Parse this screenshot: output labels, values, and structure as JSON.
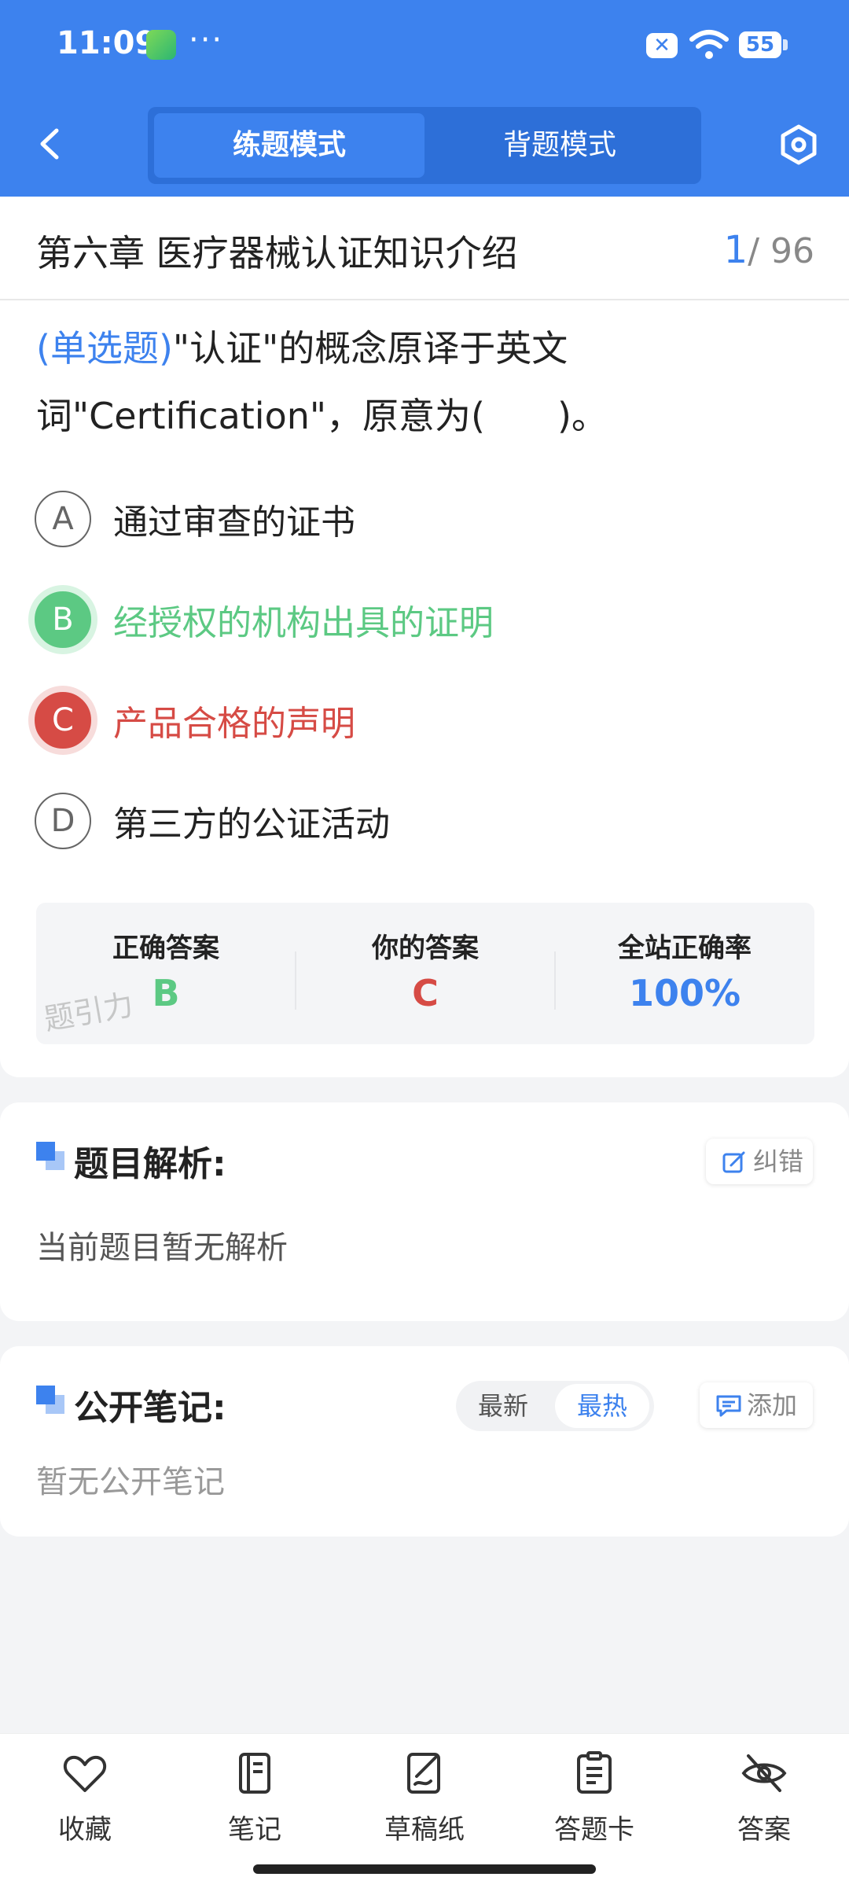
{
  "status_bar": {
    "time": "11:09",
    "more": "···",
    "battery": "55"
  },
  "header": {
    "tabs": [
      {
        "label": "练题模式",
        "active": true
      },
      {
        "label": "背题模式",
        "active": false
      }
    ]
  },
  "question": {
    "chapter": "第六章 医疗器械认证知识介绍",
    "progress_current": "1",
    "progress_total": "/ 96",
    "type": "(单选题)",
    "text": "\"认证\"的概念原译于英文词\"Certification\"，原意为(　　)。",
    "options": [
      {
        "letter": "A",
        "text": "通过审查的证书",
        "state": "normal"
      },
      {
        "letter": "B",
        "text": "经授权的机构出具的证明",
        "state": "correct"
      },
      {
        "letter": "C",
        "text": "产品合格的声明",
        "state": "wrong"
      },
      {
        "letter": "D",
        "text": "第三方的公证活动",
        "state": "normal"
      }
    ]
  },
  "answer_summary": {
    "correct_label": "正确答案",
    "correct_value": "B",
    "yours_label": "你的答案",
    "yours_value": "C",
    "rate_label": "全站正确率",
    "rate_value": "100%",
    "watermark": "题引力"
  },
  "analysis": {
    "title": "题目解析:",
    "report_button": "纠错",
    "body": "当前题目暂无解析"
  },
  "notes": {
    "title": "公开笔记:",
    "sort_options": [
      "最新",
      "最热"
    ],
    "sort_active": "最热",
    "add_button": "添加",
    "empty": "暂无公开笔记"
  },
  "bottom_nav": [
    {
      "label": "收藏",
      "icon": "heart-icon"
    },
    {
      "label": "笔记",
      "icon": "notebook-icon"
    },
    {
      "label": "草稿纸",
      "icon": "draft-icon"
    },
    {
      "label": "答题卡",
      "icon": "clipboard-icon"
    },
    {
      "label": "答案",
      "icon": "eye-off-icon"
    }
  ],
  "colors": {
    "brand_blue": "#3d82ee",
    "correct_green": "#5cc983",
    "wrong_red": "#d64b45"
  }
}
